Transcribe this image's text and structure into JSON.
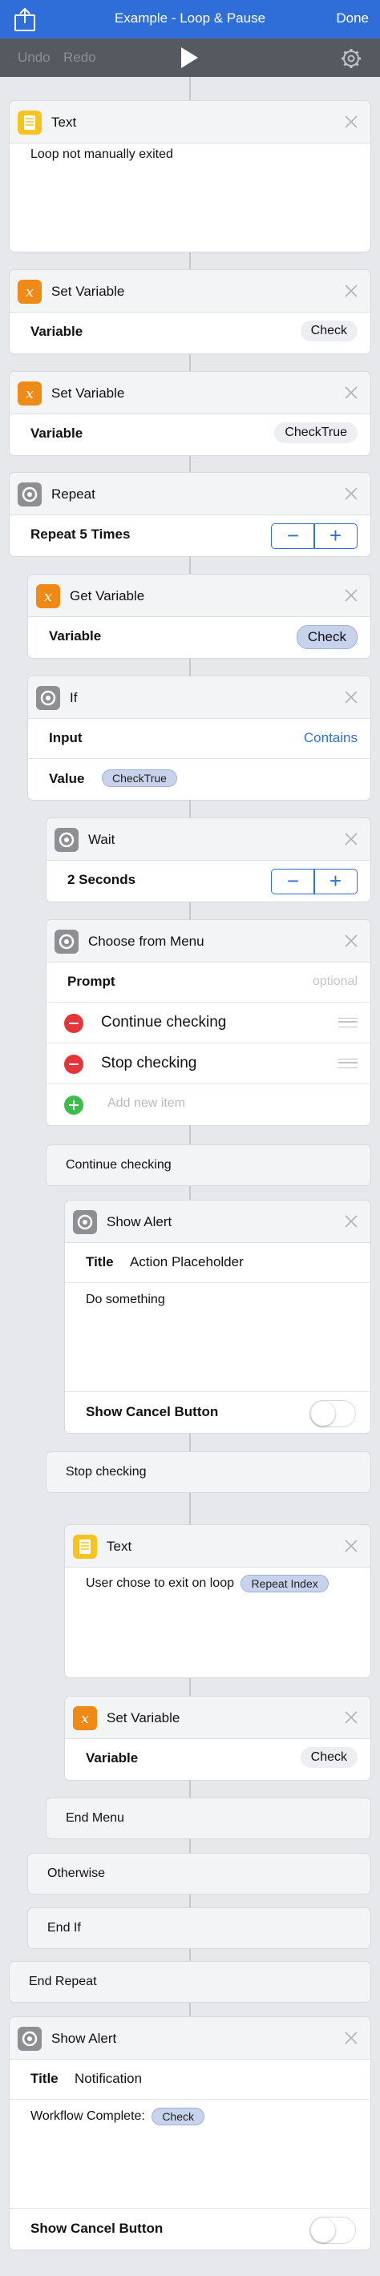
{
  "nav": {
    "title": "Example - Loop &  Pause",
    "done": "Done"
  },
  "toolbar": {
    "undo": "Undo",
    "redo": "Redo"
  },
  "a1": {
    "title": "Text",
    "text": "Loop not manually exited"
  },
  "a2": {
    "title": "Set Variable",
    "label": "Variable",
    "value": "Check"
  },
  "a3": {
    "title": "Set Variable",
    "label": "Variable",
    "value": "CheckTrue"
  },
  "a4": {
    "title": "Repeat",
    "label": "Repeat 5 Times",
    "minus": "−",
    "plus": "+"
  },
  "a5": {
    "title": "Get Variable",
    "label": "Variable",
    "value": "Check"
  },
  "a6": {
    "title": "If",
    "input_label": "Input",
    "input_value": "Contains",
    "value_label": "Value",
    "value_token": "CheckTrue"
  },
  "a7": {
    "title": "Wait",
    "label": "2 Seconds",
    "minus": "−",
    "plus": "+"
  },
  "a8": {
    "title": "Choose from Menu",
    "prompt_label": "Prompt",
    "prompt_placeholder": "optional",
    "item1": "Continue checking",
    "item2": "Stop checking",
    "add": "Add new item"
  },
  "case1": "Continue checking",
  "a9": {
    "title": "Show Alert",
    "title_label": "Title",
    "title_value": "Action Placeholder",
    "body": "Do something",
    "cancel_label": "Show Cancel Button"
  },
  "case2": "Stop checking",
  "a10": {
    "title": "Text",
    "text": "User chose to exit on loop",
    "token": "Repeat Index"
  },
  "a11": {
    "title": "Set Variable",
    "label": "Variable",
    "value": "Check"
  },
  "end_menu": "End Menu",
  "otherwise": "Otherwise",
  "end_if": "End If",
  "end_repeat": "End Repeat",
  "a12": {
    "title": "Show Alert",
    "title_label": "Title",
    "title_value": "Notification",
    "body": "Workflow Complete:",
    "token": "Check",
    "cancel_label": "Show Cancel Button"
  },
  "colors": {
    "accent": "#2f6ed8",
    "toolbar": "#555a61",
    "yellow": "#f7c31c",
    "orange": "#f08a16",
    "gray": "#8e8e93",
    "red": "#e5343a",
    "green": "#3dbd4e"
  }
}
